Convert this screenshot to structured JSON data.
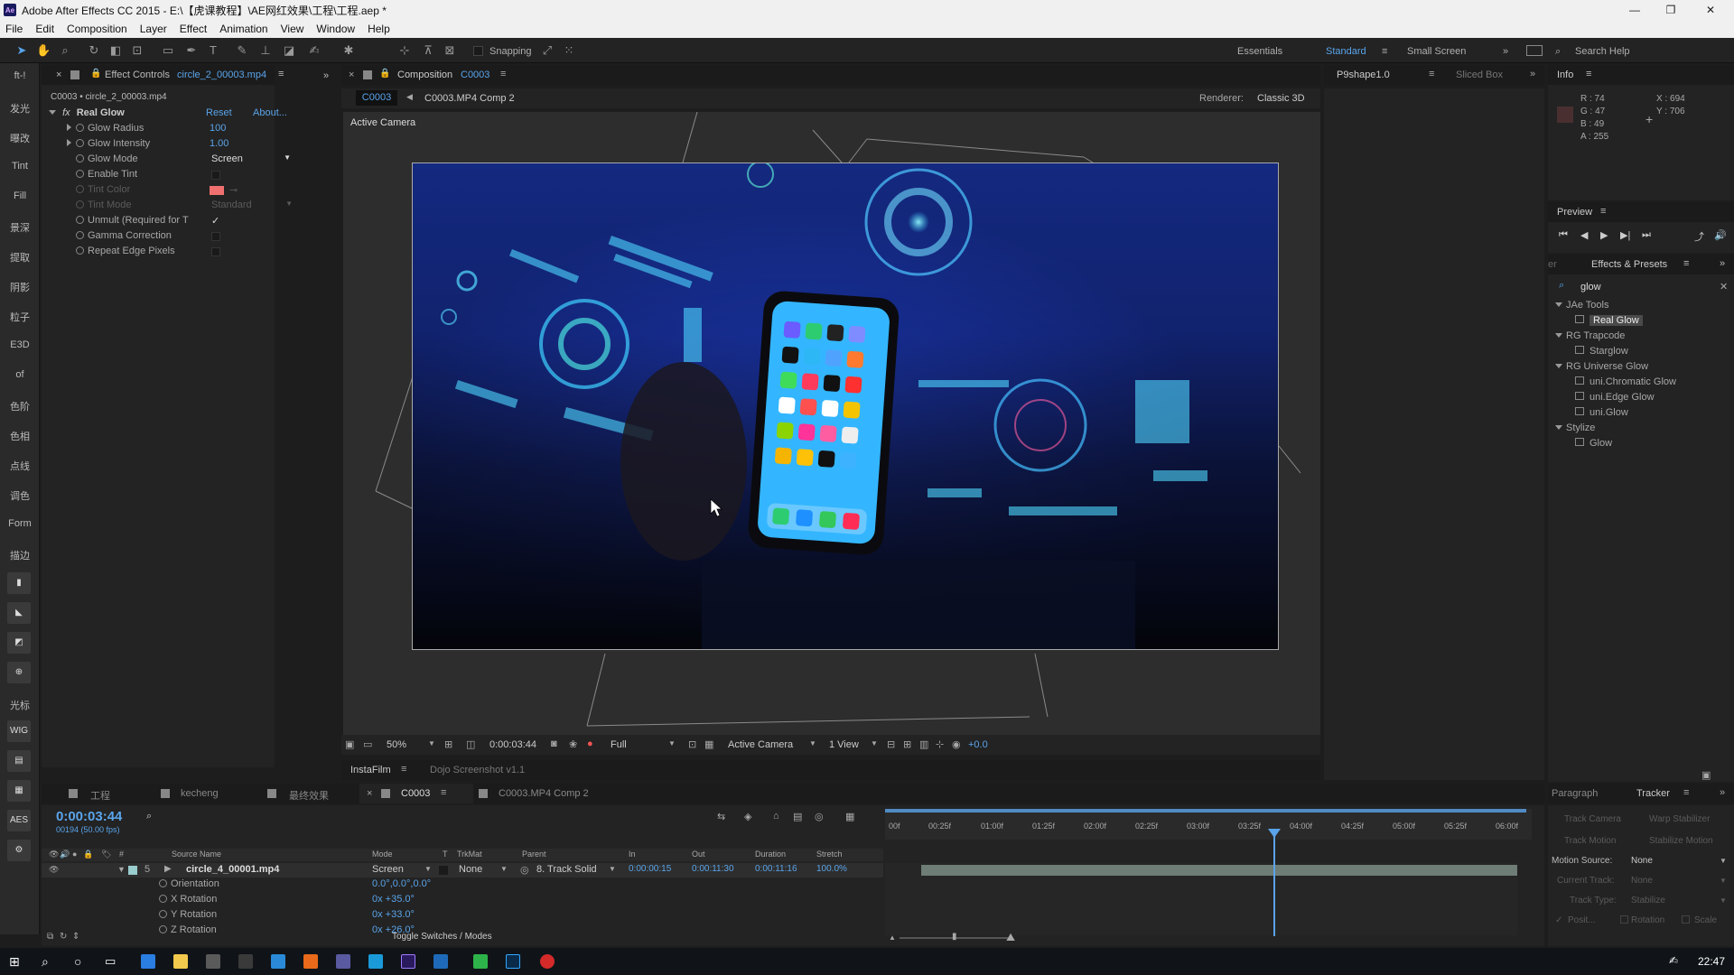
{
  "window": {
    "title": "Adobe After Effects CC 2015 - E:\\【虎课教程】\\AE网红效果\\工程\\工程.aep *",
    "app_icon": "Ae"
  },
  "menu": [
    "File",
    "Edit",
    "Composition",
    "Layer",
    "Effect",
    "Animation",
    "View",
    "Window",
    "Help"
  ],
  "toolbar": {
    "snapping_label": "Snapping",
    "workspaces": [
      "Essentials",
      "Standard",
      "Small Screen"
    ],
    "active_workspace": "Standard",
    "search_help": "Search Help"
  },
  "left_bar": {
    "labels": [
      "ft-!",
      "发光",
      "曝改",
      "Tint",
      "Fill",
      "景深",
      "提取",
      "阴影",
      "粒子",
      "E3D",
      "of",
      "色阶",
      "色相",
      "点线",
      "调色",
      "Form",
      "描边"
    ],
    "lower_labels": [
      "光标",
      "WIG",
      "AES"
    ]
  },
  "effect_controls": {
    "tab_label": "Effect Controls",
    "tab_layer": "circle_2_00003.mp4",
    "breadcrumb": "C0003 • circle_2_00003.mp4",
    "effect_name": "Real Glow",
    "reset": "Reset",
    "about": "About...",
    "props": [
      {
        "label": "Glow Radius",
        "value": "100",
        "type": "num"
      },
      {
        "label": "Glow Intensity",
        "value": "1.00",
        "type": "num"
      },
      {
        "label": "Glow Mode",
        "value": "Screen",
        "type": "dropdown"
      },
      {
        "label": "Enable Tint",
        "value": "",
        "type": "check"
      },
      {
        "label": "Tint Color",
        "value": "",
        "type": "color",
        "disabled": true
      },
      {
        "label": "Tint Mode",
        "value": "Standard",
        "type": "dropdown",
        "disabled": true
      },
      {
        "label": "Unmult (Required for T",
        "value": "✓",
        "type": "check"
      },
      {
        "label": "Gamma Correction",
        "value": "",
        "type": "check"
      },
      {
        "label": "Repeat Edge Pixels",
        "value": "",
        "type": "check"
      }
    ],
    "tint_color": "#f07070"
  },
  "composition": {
    "tab_label": "Composition",
    "tab_comp": "C0003",
    "flow_current": "C0003",
    "flow_next": "C0003.MP4 Comp 2",
    "renderer_label": "Renderer:",
    "renderer_value": "Classic 3D",
    "camera_label": "Active Camera",
    "footer": {
      "zoom": "50%",
      "timecode": "0:00:03:44",
      "resolution": "Full",
      "camera": "Active Camera",
      "views": "1 View",
      "exposure": "+0.0"
    }
  },
  "side_tabs": {
    "p9shape": "P9shape1.0",
    "sliced_box": "Sliced Box"
  },
  "info_panel": {
    "title": "Info",
    "r": "R : 74",
    "g": "G : 47",
    "b": "B : 49",
    "a": "A : 255",
    "x": "X : 694",
    "y": "Y : 706",
    "swatch": "#4a2f31"
  },
  "preview_panel": {
    "title": "Preview"
  },
  "effects_presets": {
    "title": "Effects & Presets",
    "search_value": "glow",
    "groups": [
      {
        "name": "JAe Tools",
        "items": [
          "Real Glow"
        ]
      },
      {
        "name": "RG Trapcode",
        "items": [
          "Starglow"
        ]
      },
      {
        "name": "RG Universe Glow",
        "items": [
          "uni.Chromatic Glow",
          "uni.Edge Glow",
          "uni.Glow"
        ]
      },
      {
        "name": "Stylize",
        "items": [
          "Glow"
        ]
      }
    ],
    "selected": "Real Glow"
  },
  "lower_tabs": {
    "instafilm": "InstaFilm",
    "dojo": "Dojo Screenshot v1.1"
  },
  "timeline": {
    "tabs": [
      "工程",
      "kecheng",
      "最终效果",
      "C0003",
      "C0003.MP4 Comp 2"
    ],
    "active_tab": "C0003",
    "timecode": "0:00:03:44",
    "fps": "00194 (50.00 fps)",
    "ruler": [
      "00f",
      "00:25f",
      "01:00f",
      "01:25f",
      "02:00f",
      "02:25f",
      "03:00f",
      "03:25f",
      "04:00f",
      "04:25f",
      "05:00f",
      "05:25f",
      "06:00f"
    ],
    "columns": {
      "num": "#",
      "source": "Source Name",
      "mode": "Mode",
      "t": "T",
      "trkmat": "TrkMat",
      "parent": "Parent",
      "in": "In",
      "out": "Out",
      "duration": "Duration",
      "stretch": "Stretch"
    },
    "layer": {
      "num": "5",
      "name": "circle_4_00001.mp4",
      "mode": "Screen",
      "trkmat": "None",
      "parent": "8. Track Solid",
      "in": "0:00:00:15",
      "out": "0:00:11:30",
      "duration": "0:00:11:16",
      "stretch": "100.0%"
    },
    "sub_props": [
      {
        "label": "Orientation",
        "value": "0.0°,0.0°,0.0°"
      },
      {
        "label": "X Rotation",
        "value": "0x +35.0°"
      },
      {
        "label": "Y Rotation",
        "value": "0x +33.0°"
      },
      {
        "label": "Z Rotation",
        "value": "0x +26.0°"
      }
    ],
    "toggle_label": "Toggle Switches / Modes"
  },
  "tracker": {
    "tabs": [
      "Paragraph",
      "Tracker"
    ],
    "buttons": [
      "Track Camera",
      "Warp Stabilizer",
      "Track Motion",
      "Stabilize Motion"
    ],
    "motion_source_label": "Motion Source:",
    "motion_source_value": "None",
    "current_track_label": "Current Track:",
    "current_track_value": "None",
    "track_type_label": "Track Type:",
    "track_type_value": "Stabilize",
    "checks": [
      "Posit...",
      "Rotation",
      "Scale"
    ]
  },
  "taskbar": {
    "clock": "22:47"
  }
}
